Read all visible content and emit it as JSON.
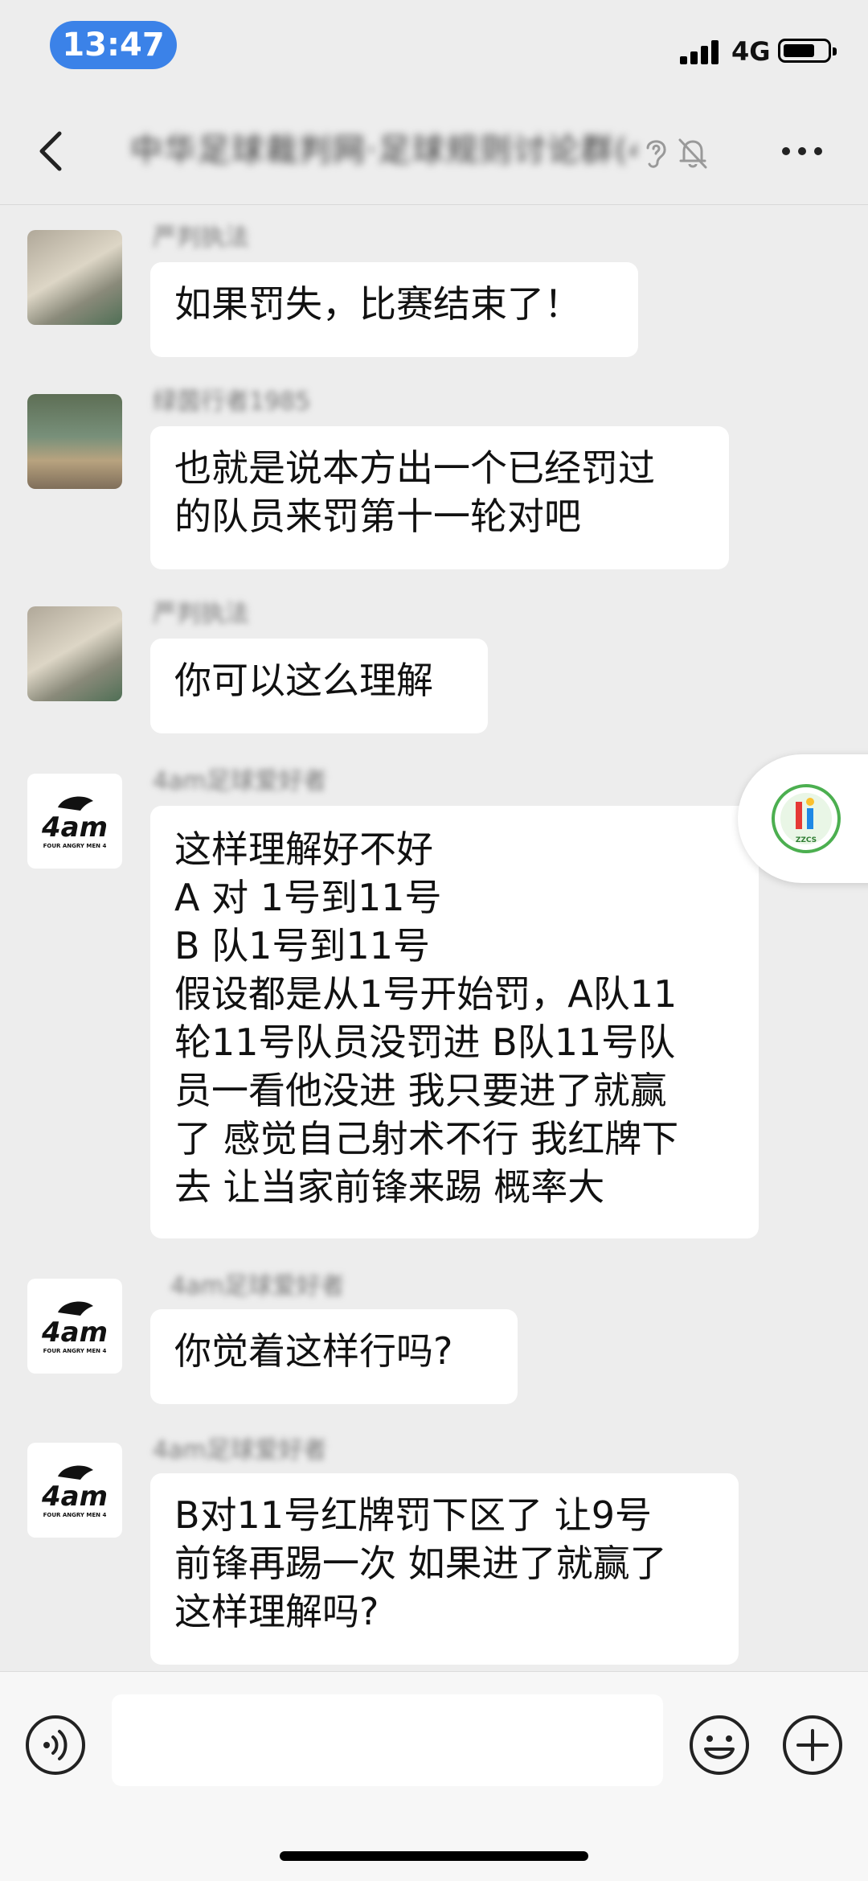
{
  "status_bar": {
    "time": "13:47",
    "network": "4G"
  },
  "header": {
    "title": "中华足球裁判网·足球规则讨论群(481)"
  },
  "messages": [
    {
      "sender": "严判执法",
      "avatar": "photo1",
      "lines": [
        "如果罚失，比赛结束了！"
      ]
    },
    {
      "sender": "绿茵行者1985",
      "avatar": "photo2",
      "lines": [
        "也就是说本方出一个已经罚过",
        "的队员来罚第十一轮对吧"
      ]
    },
    {
      "sender": "严判执法",
      "avatar": "photo1",
      "lines": [
        "你可以这么理解"
      ]
    },
    {
      "sender": "4am足球爱好者",
      "avatar": "4am",
      "lines": [
        "这样理解好不好",
        "A 对 1号到11号",
        "B 队1号到11号",
        "假设都是从1号开始罚，A队11",
        "轮11号队员没罚进  B队11号队",
        "员一看他没进  我只要进了就赢",
        "了  感觉自己射术不行 我红牌下",
        "去 让当家前锋来踢 概率大"
      ]
    },
    {
      "sender": "4am足球爱好者",
      "avatar": "4am",
      "lines": [
        "你觉着这样行吗?"
      ]
    },
    {
      "sender": "4am足球爱好者",
      "avatar": "4am",
      "lines": [
        "B对11号红牌罚下区了 让9号",
        "前锋再踢一次 如果进了就赢了",
        "这样理解吗?"
      ]
    }
  ],
  "avatar_4am": {
    "main": "4am",
    "sub": "FOUR ANGRY MEN 4"
  },
  "float_badge": {
    "text": "ZZCS"
  },
  "icons": [
    "back-arrow-icon",
    "ear-icon",
    "mute-bell-icon",
    "more-icon",
    "voice-icon",
    "emoji-icon",
    "plus-icon"
  ]
}
